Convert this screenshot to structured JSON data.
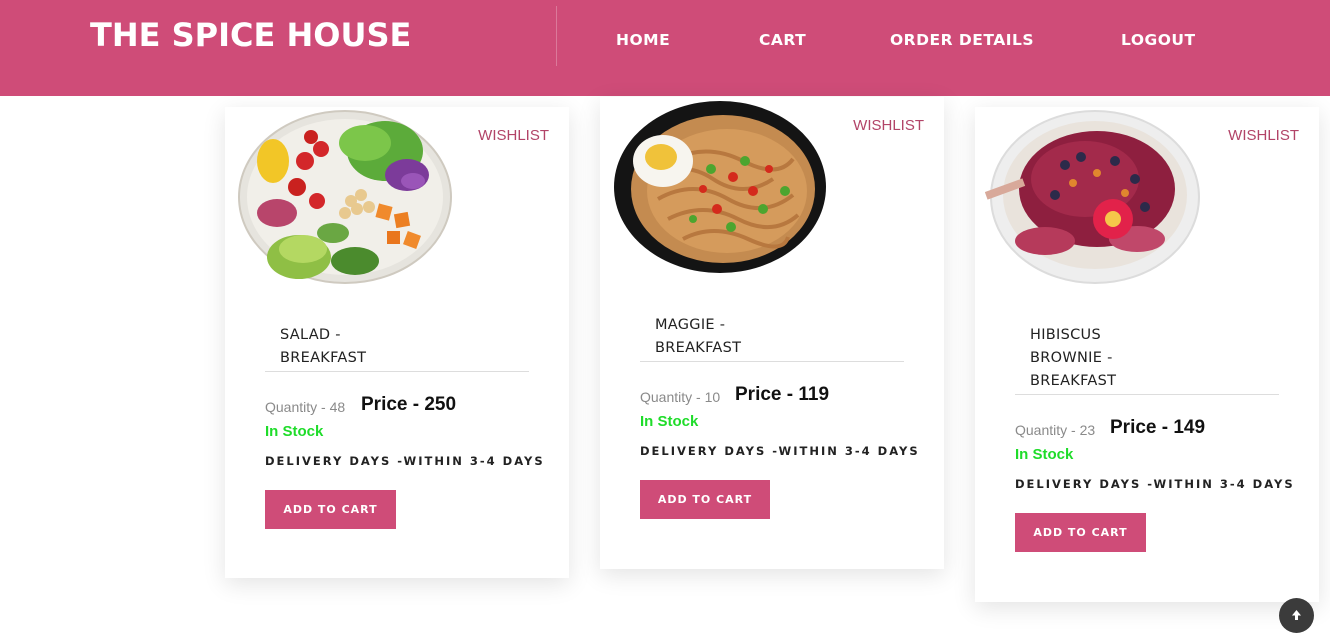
{
  "header": {
    "brand": "THE SPICE HOUSE",
    "nav": [
      {
        "label": "HOME"
      },
      {
        "label": "CART"
      },
      {
        "label": "ORDER DETAILS"
      },
      {
        "label": "LOGOUT"
      }
    ]
  },
  "products": [
    {
      "wishlist": "WISHLIST",
      "name_lines": [
        "SALAD -",
        "BREAKFAST"
      ],
      "quantity": "Quantity - 48",
      "price": "Price - 250",
      "stock": "In Stock",
      "delivery": "DELIVERY DAYS -WITHIN 3-4 DAYS",
      "button": "ADD TO CART",
      "image": "salad-bowl"
    },
    {
      "wishlist": "WISHLIST",
      "name_lines": [
        "MAGGIE -",
        "BREAKFAST"
      ],
      "quantity": "Quantity - 10",
      "price": "Price - 119",
      "stock": "In Stock",
      "delivery": "DELIVERY DAYS -WITHIN 3-4 DAYS",
      "button": "ADD TO CART",
      "image": "noodle-bowl"
    },
    {
      "wishlist": "WISHLIST",
      "name_lines": [
        "HIBISCUS",
        "BROWNIE -",
        "BREAKFAST"
      ],
      "quantity": "Quantity - 23",
      "price": "Price - 149",
      "stock": "In Stock",
      "delivery": "DELIVERY DAYS -WITHIN 3-4 DAYS",
      "button": "ADD TO CART",
      "image": "acai-bowl"
    }
  ],
  "colors": {
    "brand": "#cf4c78",
    "stock": "#1fdc2a",
    "wishlist": "#b24468"
  },
  "scroll_top_icon": "arrow-up-icon"
}
